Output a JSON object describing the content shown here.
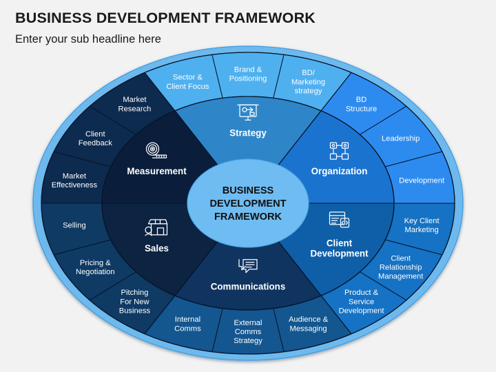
{
  "header": {
    "title": "BUSINESS DEVELOPMENT FRAMEWORK",
    "subtitle": "Enter your sub headline here"
  },
  "center": {
    "line1": "BUSINESS",
    "line2": "DEVELOPMENT",
    "line3": "FRAMEWORK",
    "fill": "#6FBCF2"
  },
  "colors": {
    "background": "#f2f2f2",
    "rim": "#6DB9EE",
    "rim_outline": "#3F9BE0",
    "divider": "#071528"
  },
  "chart_data": {
    "type": "pie",
    "title": "BUSINESS DEVELOPMENT FRAMEWORK",
    "legend": "none",
    "sector_count": 6,
    "segments_per_sector": 3,
    "sectors": [
      {
        "name": "Strategy",
        "icon": "presentation-board-icon",
        "inner_fill": "#2E86C8",
        "outer_fill": "#4FB0F0",
        "start_angle": 240,
        "end_angle": 300,
        "segments": [
          "Sector &\nClient Focus",
          "Brand &\nPositioning",
          "BD/\nMarketing\nstrategy"
        ]
      },
      {
        "name": "Organization",
        "icon": "org-chart-icon",
        "inner_fill": "#1B73D0",
        "outer_fill": "#2D8BF0",
        "start_angle": 300,
        "end_angle": 360,
        "segments": [
          "BD\nStructure",
          "Leadership",
          "Development"
        ]
      },
      {
        "name": "Client\nDevelopment",
        "icon": "code-window-icon",
        "inner_fill": "#0F5FA8",
        "outer_fill": "#1572C4",
        "start_angle": 0,
        "end_angle": 60,
        "segments": [
          "Key Client\nMarketing",
          "Client\nRelationship\nManagement",
          "Product &\nService\nDevelopment"
        ]
      },
      {
        "name": "Communications",
        "icon": "speech-bubbles-icon",
        "inner_fill": "#0F3460",
        "outer_fill": "#14568F",
        "start_angle": 60,
        "end_angle": 120,
        "segments": [
          "Audience &\nMessaging",
          "External\nComms\nStrategy",
          "Internal\nComms"
        ]
      },
      {
        "name": "Sales",
        "icon": "storefront-icon",
        "inner_fill": "#0C2342",
        "outer_fill": "#0E3A64",
        "start_angle": 120,
        "end_angle": 180,
        "segments": [
          "Pitching\nFor New\nBusiness",
          "Pricing &\nNegotiation",
          "Selling"
        ]
      },
      {
        "name": "Measurement",
        "icon": "tape-measure-icon",
        "inner_fill": "#0A1E3C",
        "outer_fill": "#0D2A4F",
        "start_angle": 180,
        "end_angle": 240,
        "segments": [
          "Market\nEffectiveness",
          "Client\nFeedback",
          "Market\nResearch"
        ]
      }
    ]
  }
}
